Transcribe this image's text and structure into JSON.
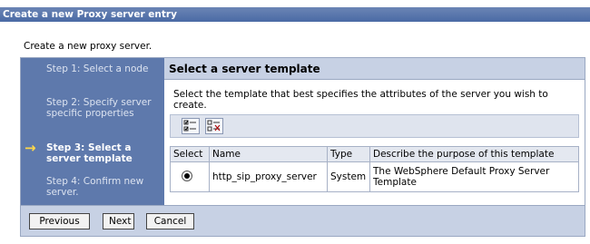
{
  "window": {
    "title": "Create a new Proxy server entry"
  },
  "intro": "Create a new proxy server.",
  "steps": [
    {
      "label": "Step 1: Select a node",
      "current": false
    },
    {
      "label": "Step 2: Specify server specific properties",
      "current": false
    },
    {
      "label": "Step 3: Select a server template",
      "current": true
    },
    {
      "label": "Step 4: Confirm new server.",
      "current": false
    }
  ],
  "content": {
    "title": "Select a server template",
    "description": "Select the template that best specifies the attributes of the server you wish to create.",
    "toolbar": [
      {
        "icon": "select-all-icon"
      },
      {
        "icon": "deselect-all-icon"
      }
    ],
    "table": {
      "headers": [
        "Select",
        "Name",
        "Type",
        "Describe the purpose of this template"
      ],
      "rows": [
        {
          "selected": true,
          "name": "http_sip_proxy_server",
          "type": "System",
          "description": "The WebSphere Default Proxy Server Template"
        }
      ]
    }
  },
  "buttons": {
    "previous": "Previous",
    "next": "Next",
    "cancel": "Cancel"
  },
  "colors": {
    "titlebar": "#4a6aa5",
    "step_panel": "#5e79ac",
    "header_band": "#c7d1e4",
    "arrow": "#ffd84a"
  }
}
